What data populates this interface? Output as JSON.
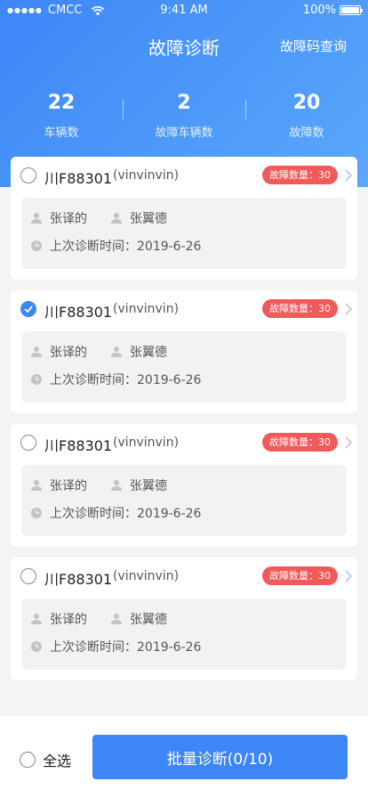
{
  "status_bar": {
    "carrier": "CMCC",
    "time": "9:41 AM",
    "battery": "100%",
    "battery_level": 1.0
  },
  "nav": {
    "title": "故障诊断",
    "action": "故障码查询"
  },
  "stats": [
    {
      "value": "22",
      "label": "车辆数"
    },
    {
      "value": "2",
      "label": "故障车辆数"
    },
    {
      "value": "20",
      "label": "故障数"
    }
  ],
  "cards": [
    {
      "plate": "川F88301",
      "vin": "(vinvinvin)",
      "badge": "故障数量：30",
      "person1": "张译的",
      "person2": "张翼德",
      "diag_time": "上次诊断时间：2019-6-26",
      "checked": false
    },
    {
      "plate": "川F88301",
      "vin": "(vinvinvin)",
      "badge": "故障数量：30",
      "person1": "张译的",
      "person2": "张翼德",
      "diag_time": "上次诊断时间：2019-6-26",
      "checked": true
    },
    {
      "plate": "川F88301",
      "vin": "(vinvinvin)",
      "badge": "故障数量：30",
      "person1": "张译的",
      "person2": "张翼德",
      "diag_time": "上次诊断时间：2019-6-26",
      "checked": false
    },
    {
      "plate": "川F88301",
      "vin": "(vinvinvin)",
      "badge": "故障数量：30",
      "person1": "张译的",
      "person2": "张翼德",
      "diag_time": "上次诊断时间：2019-6-26",
      "checked": false
    }
  ],
  "bottom": {
    "select_all": "全选",
    "batch_button": "批量诊断(0/10)"
  },
  "colors": {
    "primary": "#3d86f7",
    "badge": "#f05a5a"
  },
  "icons": [
    "wifi-icon",
    "battery-icon",
    "radio-icon",
    "check-icon",
    "person-icon",
    "clock-icon",
    "chevron-right-icon"
  ]
}
